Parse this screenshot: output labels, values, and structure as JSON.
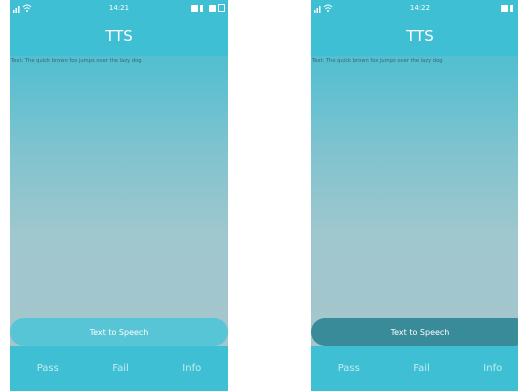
{
  "screens": [
    {
      "status_time": "14:21",
      "title": "TTS",
      "text_line": "Text: The quick brown fox jumps over the lazy dog",
      "tts_button": "Text to Speech",
      "bottom": {
        "pass": "Pass",
        "fail": "Fail",
        "info": "Info"
      },
      "status_icons": [
        "signal-icon",
        "wifi-icon",
        "sim-icon",
        "mute-icon",
        "battery-icon",
        "charging-icon"
      ]
    },
    {
      "status_time": "14:22",
      "title": "TTS",
      "text_line": "Text: The quick brown fox jumps over the lazy dog",
      "tts_button": "Text to Speech",
      "bottom": {
        "pass": "Pass",
        "fail": "Fail",
        "info": "Info"
      },
      "status_icons": [
        "signal-icon",
        "wifi-icon",
        "sim-icon",
        "mute-icon",
        "battery-icon"
      ]
    }
  ]
}
